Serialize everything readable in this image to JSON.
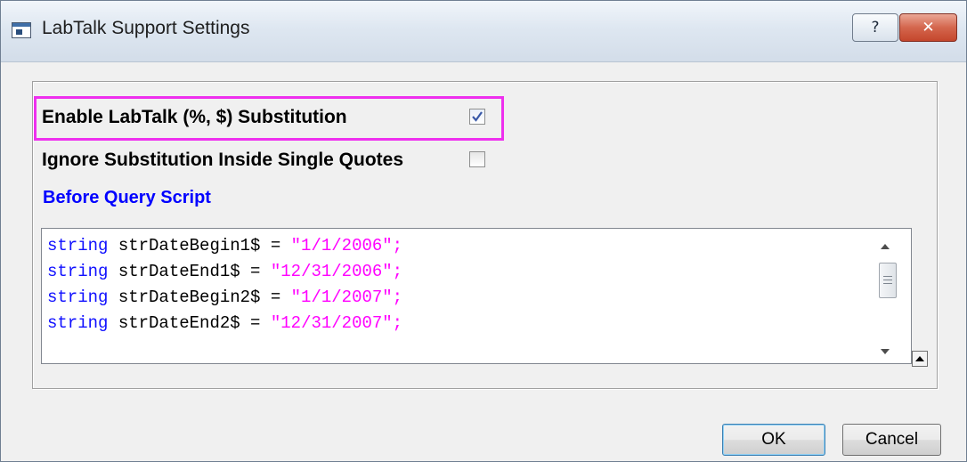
{
  "window": {
    "title": "LabTalk Support Settings",
    "help_glyph": "?",
    "close_glyph": "✕"
  },
  "options": {
    "enable_substitution": {
      "label": "Enable LabTalk (%, $) Substitution",
      "checked": true
    },
    "ignore_quotes": {
      "label": "Ignore Substitution Inside Single Quotes",
      "checked": false
    }
  },
  "script": {
    "label": "Before Query Script",
    "lines": [
      {
        "keyword": "string",
        "name": " strDateBegin1$ = ",
        "value": "\"1/1/2006\";"
      },
      {
        "keyword": "string",
        "name": " strDateEnd1$ = ",
        "value": "\"12/31/2006\";"
      },
      {
        "keyword": "string",
        "name": " strDateBegin2$ = ",
        "value": "\"1/1/2007\";"
      },
      {
        "keyword": "string",
        "name": " strDateEnd2$ = ",
        "value": "\"12/31/2007\";"
      }
    ]
  },
  "buttons": {
    "ok": "OK",
    "cancel": "Cancel"
  },
  "colors": {
    "highlight": "#ee30ee",
    "section_label": "#0000ff",
    "keyword": "#1010ff",
    "string_literal": "#ff00ff"
  }
}
